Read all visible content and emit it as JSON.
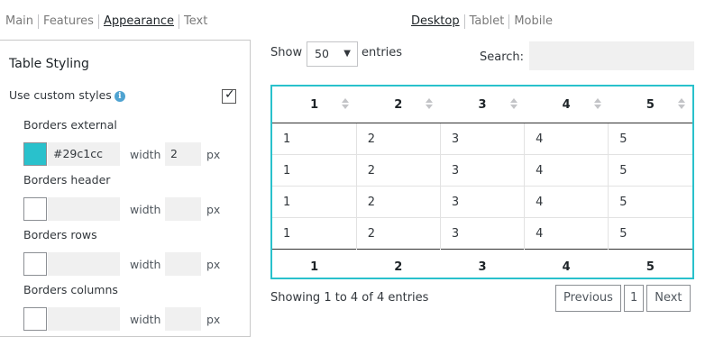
{
  "left_tabs": [
    "Main",
    "Features",
    "Appearance",
    "Text"
  ],
  "left_tabs_active": "Appearance",
  "right_tabs": [
    "Desktop",
    "Tablet",
    "Mobile"
  ],
  "right_tabs_active": "Desktop",
  "panel": {
    "title": "Table Styling",
    "use_custom_styles": {
      "label": "Use custom styles",
      "info_icon": "i",
      "checked": true,
      "check_glyph": "✓"
    },
    "borders_external": {
      "label": "Borders external",
      "color": "#29c1cc",
      "width_label": "width",
      "width_value": "2",
      "unit": "px"
    },
    "borders_header": {
      "label": "Borders header",
      "color": "",
      "width_label": "width",
      "width_value": "",
      "unit": "px"
    },
    "borders_rows": {
      "label": "Borders rows",
      "color": "",
      "width_label": "width",
      "width_value": "",
      "unit": "px"
    },
    "borders_columns": {
      "label": "Borders columns",
      "color": "",
      "width_label": "width",
      "width_value": "",
      "unit": "px"
    }
  },
  "preview": {
    "show_label": "Show",
    "page_length": "50",
    "page_length_arrow": "▼",
    "entries_label": "entries",
    "search_label": "Search:",
    "search_value": "",
    "columns": [
      "1",
      "2",
      "3",
      "4",
      "5"
    ],
    "rows": [
      [
        "1",
        "2",
        "3",
        "4",
        "5"
      ],
      [
        "1",
        "2",
        "3",
        "4",
        "5"
      ],
      [
        "1",
        "2",
        "3",
        "4",
        "5"
      ],
      [
        "1",
        "2",
        "3",
        "4",
        "5"
      ]
    ],
    "footer": [
      "1",
      "2",
      "3",
      "4",
      "5"
    ],
    "info": "Showing 1 to 4 of 4 entries",
    "pager": {
      "previous": "Previous",
      "page": "1",
      "next": "Next"
    }
  },
  "colors": {
    "accent": "#29c1cc",
    "info_icon": "#4fa3d1"
  }
}
